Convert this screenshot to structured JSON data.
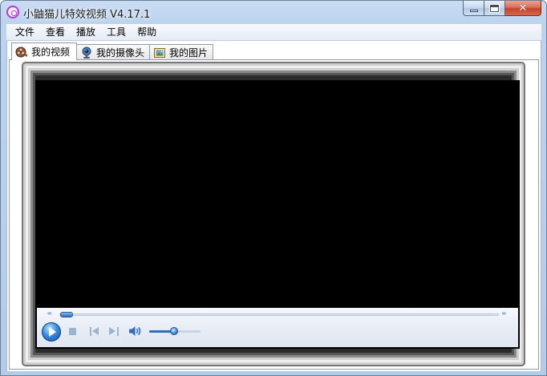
{
  "window": {
    "title": "小鼬猫儿特效视频 V4.17.1",
    "caption_buttons": {
      "minimize": "minimize",
      "maximize": "maximize",
      "close": "✕"
    }
  },
  "menubar": {
    "items": [
      "文件",
      "查看",
      "播放",
      "工具",
      "帮助"
    ]
  },
  "tabs": [
    {
      "label": "我的视频",
      "icon": "film-reel-icon",
      "active": true
    },
    {
      "label": "我的摄像头",
      "icon": "webcam-icon",
      "active": false
    },
    {
      "label": "我的图片",
      "icon": "picture-icon",
      "active": false
    }
  ],
  "player": {
    "seek_back_glyph": "◂◂",
    "seek_forward_glyph": "▸▸",
    "seek_position": 0.0,
    "volume_level": 0.5,
    "accent_color": "#2e6ebd"
  }
}
